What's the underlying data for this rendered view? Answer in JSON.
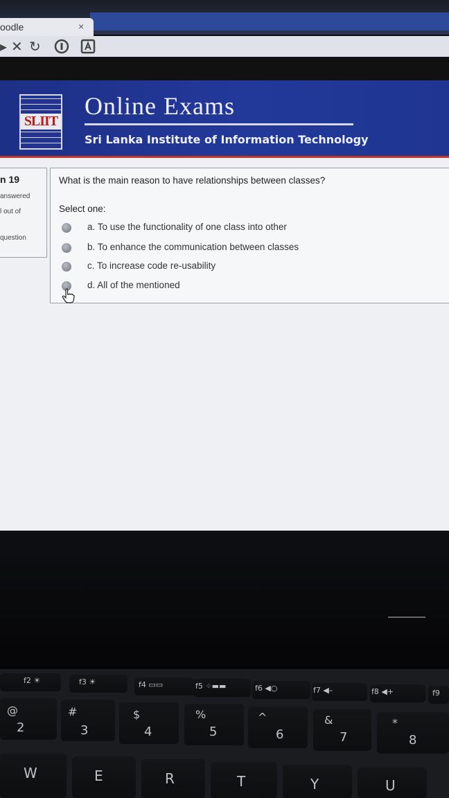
{
  "browser": {
    "tab_title": "oodle",
    "tab_close": "×",
    "toolbar_icons": [
      "forward-icon",
      "stop-icon",
      "reload-icon",
      "info-icon",
      "extension-icon"
    ]
  },
  "header": {
    "logo_text": "SLIIT",
    "title": "Online Exams",
    "subtitle": "Sri Lanka Institute of Information Technology"
  },
  "question_info": {
    "number": "n 19",
    "status": "answered",
    "marks": "l out of",
    "flag": "question"
  },
  "question": {
    "text": "What is the main reason to have relationships between classes?",
    "select_label": "Select one:",
    "options": [
      {
        "label": "a. To use the functionality of one class into other"
      },
      {
        "label": "b. To enhance the communication between classes"
      },
      {
        "label": "c. To increase code re-usability"
      },
      {
        "label": "d. All of the mentioned"
      }
    ]
  },
  "keyboard": {
    "fn_row": [
      "f2 ☀",
      "f3 ☀",
      "f4 ▭▭",
      "f5 ⁘▬▬",
      "f6 ◀○",
      "f7 ◀–",
      "f8 ◀+",
      "f9"
    ],
    "number_row": [
      {
        "top": "@",
        "bottom": "2"
      },
      {
        "top": "#",
        "bottom": "3"
      },
      {
        "top": "$",
        "bottom": "4"
      },
      {
        "top": "%",
        "bottom": "5"
      },
      {
        "top": "^",
        "bottom": "6"
      },
      {
        "top": "&",
        "bottom": "7"
      },
      {
        "top": "*",
        "bottom": "8"
      }
    ],
    "letter_row": [
      "W",
      "E",
      "R",
      "T",
      "Y",
      "U"
    ]
  },
  "colors": {
    "header_blue": "#23399a",
    "accent_red": "#c0392b",
    "page_bg": "#eef0f4"
  }
}
